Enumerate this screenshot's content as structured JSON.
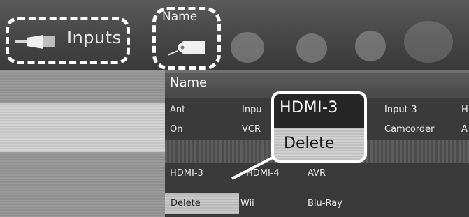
{
  "top_bar": {
    "inputs_label": "Inputs",
    "name_label": "Name",
    "inputs_icon": "input-plug-icon",
    "name_icon": "name-tag-icon"
  },
  "header": {
    "name_label": "Name"
  },
  "grid": {
    "row1": [
      "Ant",
      "Inpu",
      "",
      "Input-3",
      "H"
    ],
    "row2": [
      "On",
      "VCR",
      "",
      "Camcorder",
      "A"
    ],
    "row3": [
      "HDMI-3",
      "HDMI-4",
      "AVR"
    ],
    "row4": [
      "Delete",
      "Wii",
      "Blu-Ray"
    ]
  },
  "popup": {
    "title": "HDMI-3",
    "action": "Delete"
  },
  "colors": {
    "callout_border": "#ffffff",
    "popup_dark": "#262626",
    "highlight": "#c4c4c4"
  }
}
